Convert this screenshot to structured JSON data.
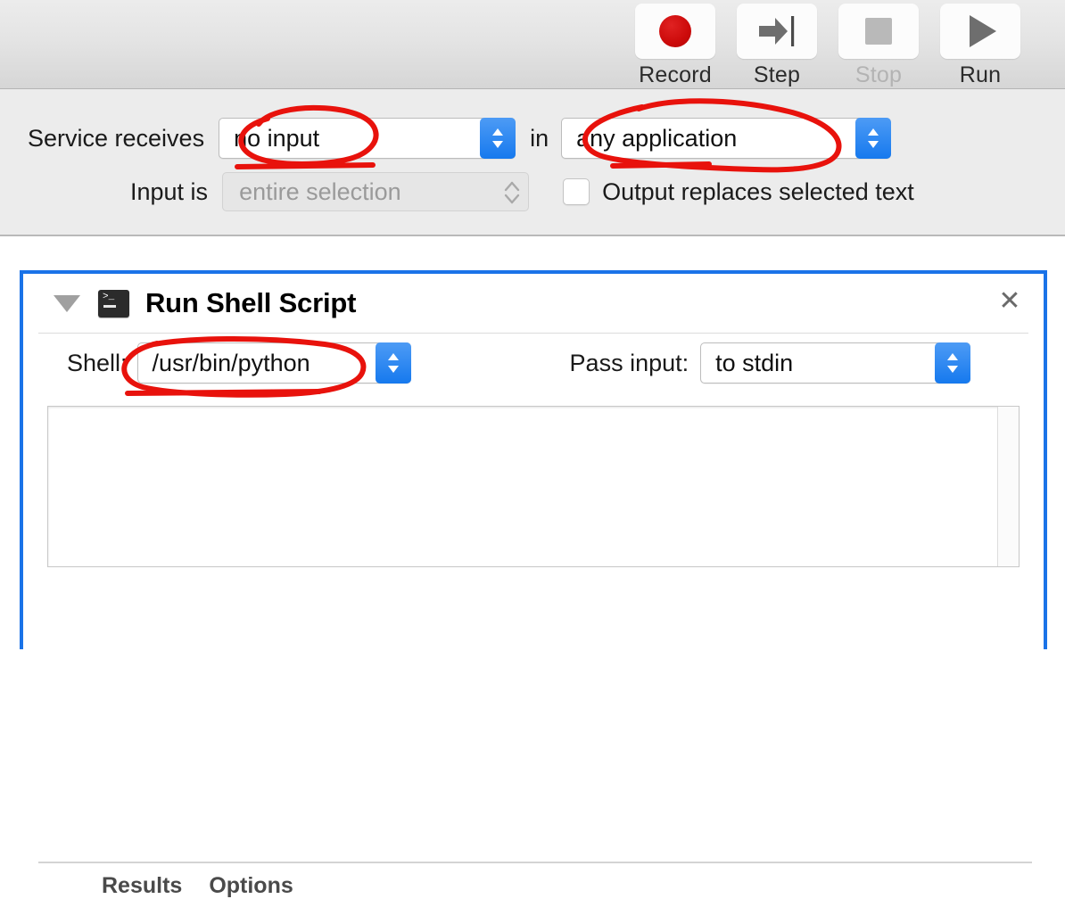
{
  "toolbar": {
    "buttons": [
      {
        "label": "Record",
        "icon": "record-circle-icon",
        "enabled": true
      },
      {
        "label": "Step",
        "icon": "step-arrow-icon",
        "enabled": true
      },
      {
        "label": "Stop",
        "icon": "stop-square-icon",
        "enabled": false
      },
      {
        "label": "Run",
        "icon": "play-triangle-icon",
        "enabled": true
      }
    ]
  },
  "config": {
    "service_receives_label": "Service receives",
    "service_receives_value": "no input",
    "in_label": "in",
    "application_value": "any application",
    "input_is_label": "Input is",
    "input_is_value": "entire selection",
    "input_is_enabled": false,
    "output_replaces_label": "Output replaces selected text",
    "output_replaces_checked": false
  },
  "action": {
    "title": "Run Shell Script",
    "icon": "terminal-icon",
    "disclosure": "triangle-down-icon",
    "close": "close-icon",
    "shell_label": "Shell:",
    "shell_value": "/usr/bin/python",
    "pass_input_label": "Pass input:",
    "pass_input_value": "to stdin",
    "script_text": "",
    "tabs": [
      {
        "label": "Results"
      },
      {
        "label": "Options"
      }
    ]
  },
  "annotations": {
    "color": "#e8120c",
    "marks": [
      {
        "name": "circle-no-input",
        "target": "no input"
      },
      {
        "name": "circle-any-application",
        "target": "any application"
      },
      {
        "name": "circle-usr-bin-python",
        "target": "/usr/bin/python"
      }
    ]
  },
  "colors": {
    "accent_blue": "#1a73e8",
    "stepper_blue": "#1679ee",
    "annotation_red": "#e8120c",
    "toolbar_bg": "#e4e4e4",
    "config_bg": "#ececec",
    "record_red": "#cc0a0a"
  }
}
